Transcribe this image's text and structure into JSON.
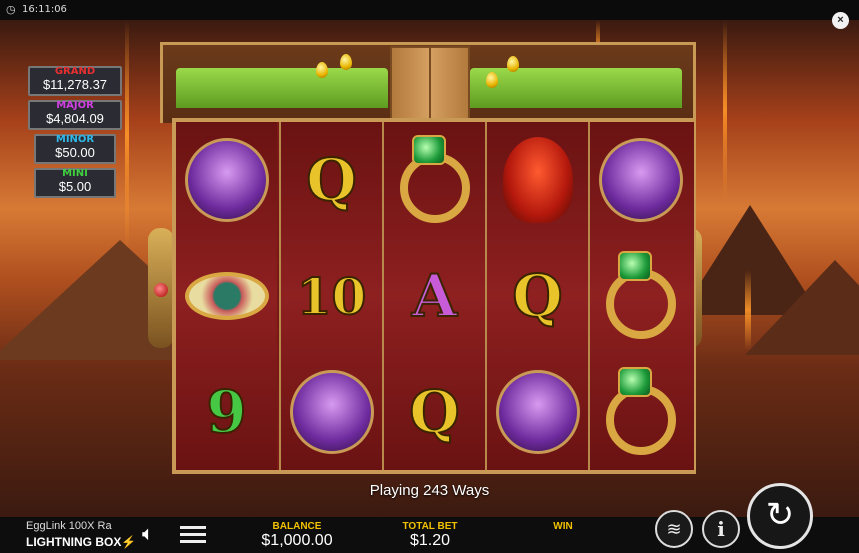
{
  "status_bar": {
    "clock_icon": "clock-icon",
    "time": "16:11:06",
    "close_label": "×"
  },
  "jackpots": [
    {
      "name": "GRAND",
      "value": "$11,278.37",
      "color": "#e83030"
    },
    {
      "name": "MAJOR",
      "value": "$4,804.09",
      "color": "#d040e0"
    },
    {
      "name": "MINOR",
      "value": "$50.00",
      "color": "#30b8e8"
    },
    {
      "name": "MINI",
      "value": "$5.00",
      "color": "#40d040"
    }
  ],
  "reels": [
    [
      "boat-symbol",
      "eye-of-horus-symbol",
      "9"
    ],
    [
      "Q",
      "10",
      "boat-symbol"
    ],
    [
      "ring-symbol",
      "A",
      "Q"
    ],
    [
      "phoenix-symbol",
      "Q",
      "boat-symbol"
    ],
    [
      "boat-symbol",
      "ring-symbol",
      "ring-symbol"
    ]
  ],
  "ways_text": "Playing 243 Ways",
  "footer": {
    "game_name": "EggLink 100X Ra",
    "brand": "LIGHTNING BOX",
    "balance_label": "BALANCE",
    "balance_value": "$1,000.00",
    "total_bet_label": "TOTAL BET",
    "total_bet_value": "$1.20",
    "win_label": "WIN",
    "win_value": ""
  },
  "icons": [
    "speaker-icon",
    "menu-icon",
    "coins-stack-icon",
    "info-icon",
    "spin-icon",
    "close-icon"
  ]
}
